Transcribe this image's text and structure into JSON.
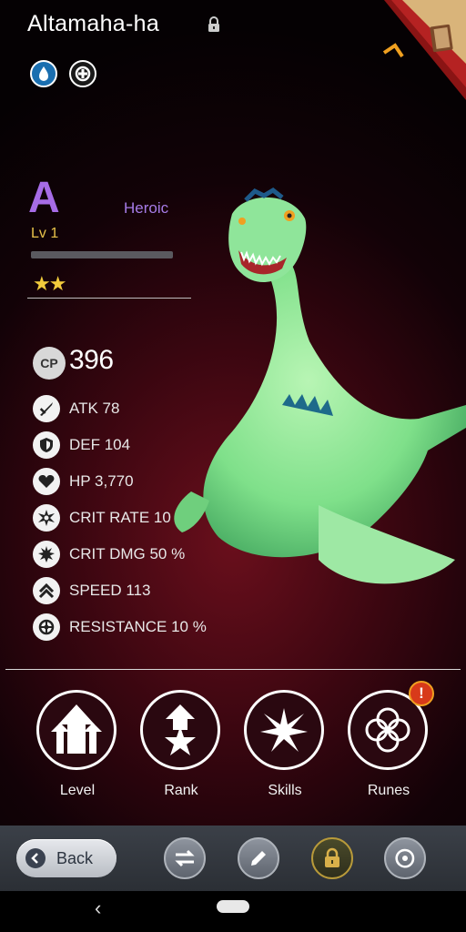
{
  "monster": {
    "name": "Altamaha-ha",
    "grade": "A",
    "rarity": "Heroic",
    "level": "Lv 1",
    "stars": "★★",
    "level_progress": 0,
    "cp_label": "CP",
    "cp_value": "396"
  },
  "elements": [
    "water-drop-icon",
    "support-role-icon"
  ],
  "stats": [
    {
      "icon": "sword-icon",
      "text": "ATK 78"
    },
    {
      "icon": "shield-icon",
      "text": "DEF 104"
    },
    {
      "icon": "heart-icon",
      "text": "HP 3,770"
    },
    {
      "icon": "crit-rate-icon",
      "text": "CRIT RATE 10 %"
    },
    {
      "icon": "crit-dmg-icon",
      "text": "CRIT DMG 50 %"
    },
    {
      "icon": "speed-icon",
      "text": "SPEED 113"
    },
    {
      "icon": "resistance-icon",
      "text": "RESISTANCE 10 %"
    }
  ],
  "actions": [
    {
      "label": "Level",
      "icon": "level-up-arrows-icon"
    },
    {
      "label": "Rank",
      "icon": "rank-star-icon"
    },
    {
      "label": "Skills",
      "icon": "skills-burst-icon"
    },
    {
      "label": "Runes",
      "icon": "runes-knot-icon",
      "alert": "!"
    }
  ],
  "toolbar": {
    "back_label": "Back",
    "buttons": [
      "swap-icon",
      "rename-pencil-icon",
      "lock-icon",
      "recycle-icon"
    ]
  },
  "colors": {
    "grade": "#a66ce6",
    "rarity": "#a67be6",
    "level": "#e8c34a",
    "stars": "#f2cc3c",
    "alert": "#d83a1a",
    "monster_body": "#7fe08a"
  }
}
